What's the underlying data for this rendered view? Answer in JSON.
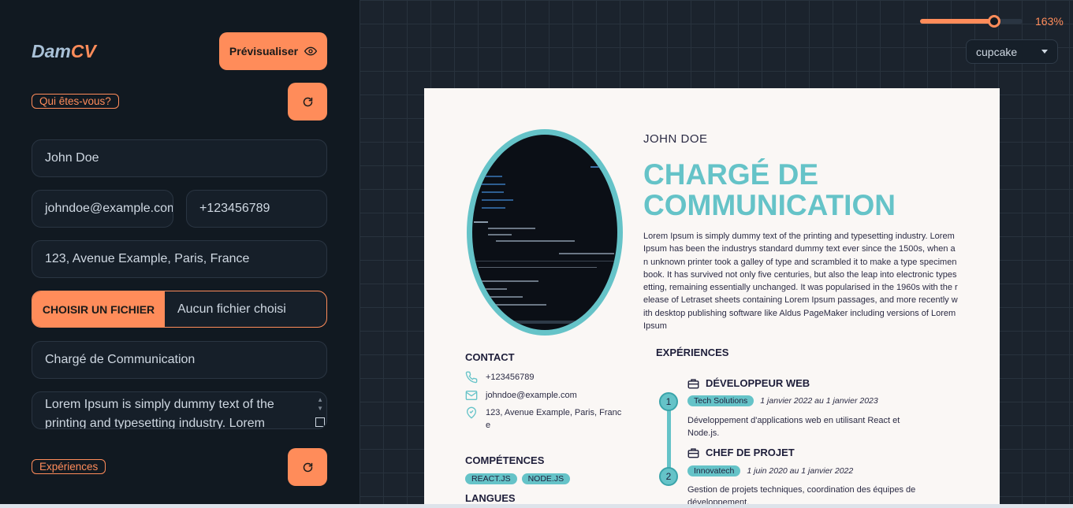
{
  "sidebar": {
    "logo_part1": "Dam",
    "logo_part2": "CV",
    "preview_label": "Prévisualiser",
    "section_identity": "Qui êtes-vous?",
    "section_experiences": "Expériences",
    "fields": {
      "name": "John Doe",
      "email": "johndoe@example.com",
      "phone": "+123456789",
      "address": "123, Avenue Example, Paris, France",
      "file_button": "CHOISIR UN FICHIER",
      "file_status": "Aucun fichier choisi",
      "job_title": "Chargé de Communication",
      "description": "Lorem Ipsum is simply dummy text of the printing and typesetting industry. Lorem"
    }
  },
  "toolbar": {
    "zoom_value": 163,
    "zoom_label": "163%",
    "zoom_fraction": 0.72,
    "theme_selected": "cupcake"
  },
  "colors": {
    "accent": "#ff8c5a",
    "cv_primary": "#65c3c8",
    "sidebar_bg": "#111921"
  },
  "cv": {
    "name": "JOHN DOE",
    "title": "CHARGÉ DE COMMUNICATION",
    "description": "Lorem Ipsum is simply dummy text of the printing and typesetting industry. Lorem Ipsum has been the industrys standard dummy text ever since the 1500s, when an unknown printer took a galley of type and scrambled it to make a type specimen book. It has survived not only five centuries, but also the leap into electronic typesetting, remaining essentially unchanged. It was popularised in the 1960s with the release of Letraset sheets containing Lorem Ipsum passages, and more recently with desktop publishing software like Aldus PageMaker including versions of Lorem Ipsum",
    "contact_heading": "CONTACT",
    "contact": {
      "phone": "+123456789",
      "email": "johndoe@example.com",
      "address": "123, Avenue Example, Paris, France"
    },
    "skills_heading": "COMPÉTENCES",
    "skills": [
      "REACT.JS",
      "NODE.JS"
    ],
    "languages_heading": "LANGUES",
    "experiences_heading": "EXPÉRIENCES",
    "experiences": [
      {
        "number": "1",
        "title": "DÉVELOPPEUR WEB",
        "company": "Tech Solutions",
        "dates": "1 janvier 2022 au 1 janvier 2023",
        "description": "Développement d'applications web en utilisant React et Node.js."
      },
      {
        "number": "2",
        "title": "CHEF DE PROJET",
        "company": "Innovatech",
        "dates": "1 juin 2020 au 1 janvier 2022",
        "description": "Gestion de projets techniques, coordination des équipes de développement."
      }
    ]
  }
}
